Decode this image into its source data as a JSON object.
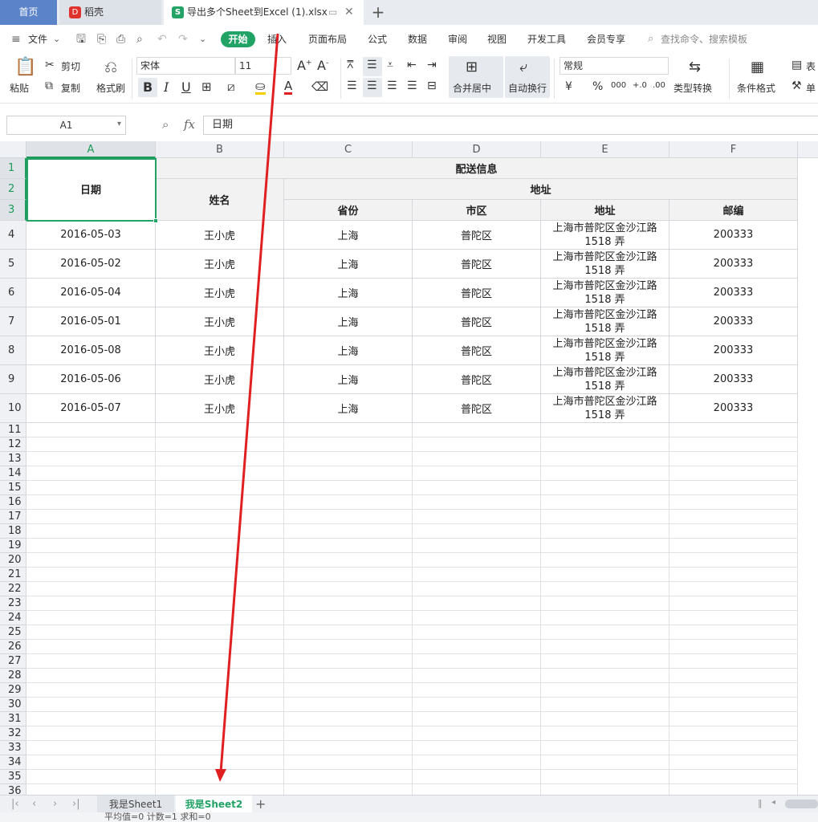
{
  "tabs": {
    "home": "首页",
    "docer": "稻壳",
    "docer_logo": "D",
    "file": "导出多个Sheet到Excel (1).xlsx",
    "file_logo": "S",
    "add": "+"
  },
  "menu": {
    "file": "文件",
    "items": [
      "开始",
      "插入",
      "页面布局",
      "公式",
      "数据",
      "审阅",
      "视图",
      "开发工具",
      "会员专享"
    ],
    "search": "查找命令、搜索模板"
  },
  "ribbon": {
    "paste": "粘贴",
    "cut": "剪切",
    "copy": "复制",
    "format_painter": "格式刷",
    "font_name": "宋体",
    "font_size": "11",
    "bold": "B",
    "italic": "I",
    "underline": "U",
    "merge_center": "合并居中",
    "wrap_text": "自动换行",
    "number_format": "常规",
    "currency": "¥",
    "percent": "%",
    "thousands": "000",
    "dec_inc": "+.0",
    "dec_dec": ".00",
    "type_convert": "类型转换",
    "cond_format": "条件格式",
    "table_style": "表",
    "cell_style": "单"
  },
  "formula_bar": {
    "name_box": "A1",
    "fx": "fx",
    "value": "日期"
  },
  "grid": {
    "columns": [
      "A",
      "B",
      "C",
      "D",
      "E",
      "F"
    ],
    "header": {
      "date": "日期",
      "name": "姓名",
      "delivery": "配送信息",
      "address_group": "地址",
      "province": "省份",
      "district": "市区",
      "address": "地址",
      "zip": "邮编"
    },
    "rows": [
      [
        "2016-05-03",
        "王小虎",
        "上海",
        "普陀区",
        "上海市普陀区金沙江路 1518 弄",
        "200333"
      ],
      [
        "2016-05-02",
        "王小虎",
        "上海",
        "普陀区",
        "上海市普陀区金沙江路 1518 弄",
        "200333"
      ],
      [
        "2016-05-04",
        "王小虎",
        "上海",
        "普陀区",
        "上海市普陀区金沙江路 1518 弄",
        "200333"
      ],
      [
        "2016-05-01",
        "王小虎",
        "上海",
        "普陀区",
        "上海市普陀区金沙江路 1518 弄",
        "200333"
      ],
      [
        "2016-05-08",
        "王小虎",
        "上海",
        "普陀区",
        "上海市普陀区金沙江路 1518 弄",
        "200333"
      ],
      [
        "2016-05-06",
        "王小虎",
        "上海",
        "普陀区",
        "上海市普陀区金沙江路 1518 弄",
        "200333"
      ],
      [
        "2016-05-07",
        "王小虎",
        "上海",
        "普陀区",
        "上海市普陀区金沙江路 1518 弄",
        "200333"
      ]
    ]
  },
  "sheets": {
    "sheet1": "我是Sheet1",
    "sheet2": "我是Sheet2",
    "add": "+"
  },
  "status": {
    "text": "平均值=0 计数=1 求和=0"
  },
  "colors": {
    "accent": "#21a366",
    "arrow": "#e02020",
    "home_tab": "#5b83c9"
  }
}
